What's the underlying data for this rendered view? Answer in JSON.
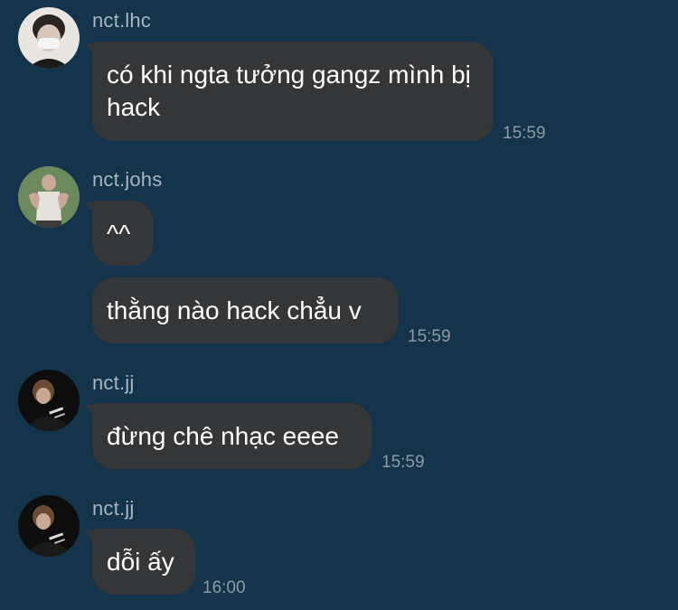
{
  "messages": [
    {
      "sender": "nct.lhc",
      "avatar": "masked-person-avatar",
      "bubbles": [
        "có khi ngta tưởng gangz mình bị hack"
      ],
      "time": "15:59"
    },
    {
      "sender": "nct.johs",
      "avatar": "person-in-tanktop-avatar",
      "bubbles": [
        "^^",
        "thằng nào hack chẳu v"
      ],
      "time": "15:59"
    },
    {
      "sender": "nct.jj",
      "avatar": "dark-person-avatar",
      "bubbles": [
        "đừng chê nhạc eeee"
      ],
      "time": "15:59"
    },
    {
      "sender": "nct.jj",
      "avatar": "dark-person-avatar",
      "bubbles": [
        "dỗi ấy"
      ],
      "time": "16:00"
    }
  ],
  "colors": {
    "background": "#13344a",
    "bubble": "#353638",
    "text": "#ffffff",
    "name": "#a9b6c2",
    "time": "#8d9aa6"
  }
}
